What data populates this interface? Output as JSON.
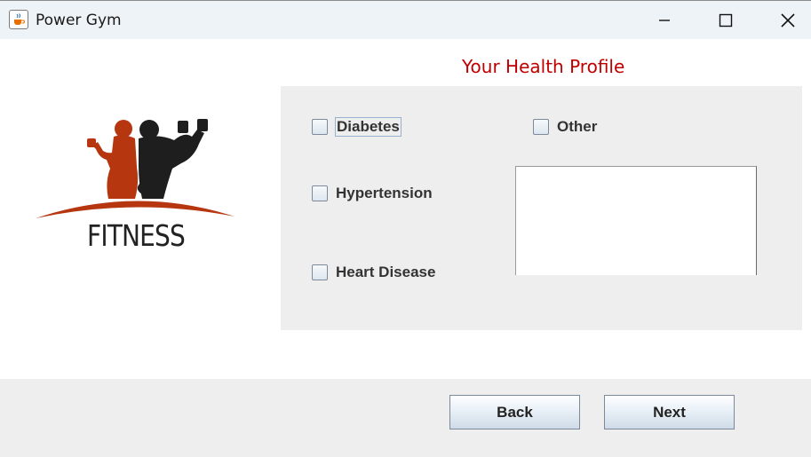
{
  "window": {
    "title": "Power Gym",
    "app_icon": "java-cup-icon"
  },
  "window_controls": {
    "minimize": "minimize-icon",
    "maximize": "maximize-icon",
    "close": "close-icon"
  },
  "logo": {
    "text": "FITNESS",
    "colors": {
      "figure_left": "#b5360f",
      "figure_right": "#1e1e1e",
      "arc": "#b5360f"
    }
  },
  "form": {
    "heading": "Your Health Profile",
    "checkboxes": {
      "diabetes": {
        "label": "Diabetes",
        "checked": false,
        "focused": true
      },
      "hypertension": {
        "label": "Hypertension",
        "checked": false
      },
      "heart_disease": {
        "label": "Heart Disease",
        "checked": false
      },
      "other": {
        "label": "Other",
        "checked": false
      }
    },
    "other_details": {
      "value": ""
    }
  },
  "footer": {
    "back_label": "Back",
    "next_label": "Next"
  },
  "colors": {
    "heading": "#c00000",
    "panel_bg": "#eeeeee",
    "titlebar_bg": "#eef3f8"
  }
}
